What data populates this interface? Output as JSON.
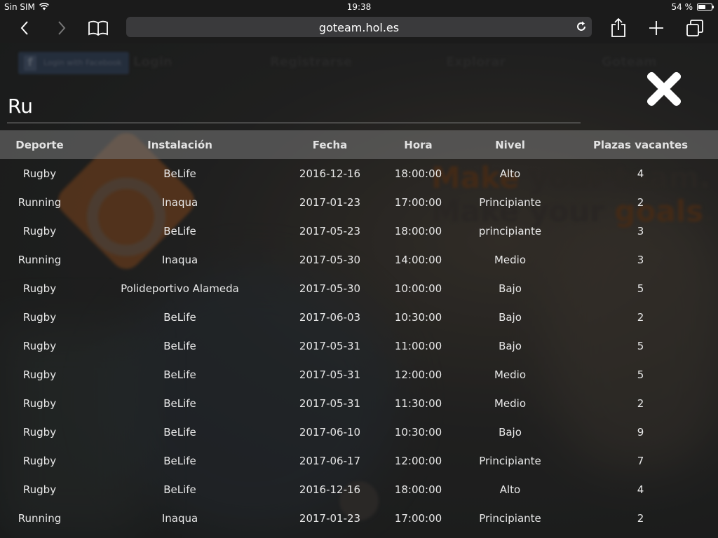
{
  "status_bar": {
    "carrier": "Sin SIM",
    "time": "19:38",
    "battery_percent": "54 %",
    "battery_level": 0.54
  },
  "browser": {
    "url": "goteam.hol.es"
  },
  "background_site": {
    "facebook_button": "Login with Facebook",
    "nav": [
      "Login",
      "Registrarse",
      "Explorar",
      "Goteam"
    ],
    "slogan_line1": [
      "Make",
      "your team."
    ],
    "slogan_line2": [
      "Make your",
      "goals",
      "."
    ]
  },
  "search": {
    "query": "Ru"
  },
  "table": {
    "headers": [
      "Deporte",
      "Instalación",
      "Fecha",
      "Hora",
      "Nivel",
      "Plazas vacantes"
    ],
    "rows": [
      [
        "Rugby",
        "BeLife",
        "2016-12-16",
        "18:00:00",
        "Alto",
        "4"
      ],
      [
        "Running",
        "Inaqua",
        "2017-01-23",
        "17:00:00",
        "Principiante",
        "2"
      ],
      [
        "Rugby",
        "BeLife",
        "2017-05-23",
        "18:00:00",
        "principiante",
        "3"
      ],
      [
        "Running",
        "Inaqua",
        "2017-05-30",
        "14:00:00",
        "Medio",
        "3"
      ],
      [
        "Rugby",
        "Polideportivo Alameda",
        "2017-05-30",
        "10:00:00",
        "Bajo",
        "5"
      ],
      [
        "Rugby",
        "BeLife",
        "2017-06-03",
        "10:30:00",
        "Bajo",
        "2"
      ],
      [
        "Rugby",
        "BeLife",
        "2017-05-31",
        "11:00:00",
        "Bajo",
        "5"
      ],
      [
        "Rugby",
        "BeLife",
        "2017-05-31",
        "12:00:00",
        "Medio",
        "5"
      ],
      [
        "Rugby",
        "BeLife",
        "2017-05-31",
        "11:30:00",
        "Medio",
        "2"
      ],
      [
        "Rugby",
        "BeLife",
        "2017-06-10",
        "10:30:00",
        "Bajo",
        "9"
      ],
      [
        "Rugby",
        "BeLife",
        "2017-06-17",
        "12:00:00",
        "Principiante",
        "7"
      ],
      [
        "Rugby",
        "BeLife",
        "2016-12-16",
        "18:00:00",
        "Alto",
        "4"
      ],
      [
        "Running",
        "Inaqua",
        "2017-01-23",
        "17:00:00",
        "Principiante",
        "2"
      ]
    ]
  },
  "icons": {
    "back": "chevron-left-icon",
    "forward": "chevron-right-icon",
    "bookmarks": "book-icon",
    "reload": "reload-icon",
    "share": "share-icon",
    "new_tab": "plus-icon",
    "tabs": "tabs-icon",
    "close": "close-icon"
  }
}
